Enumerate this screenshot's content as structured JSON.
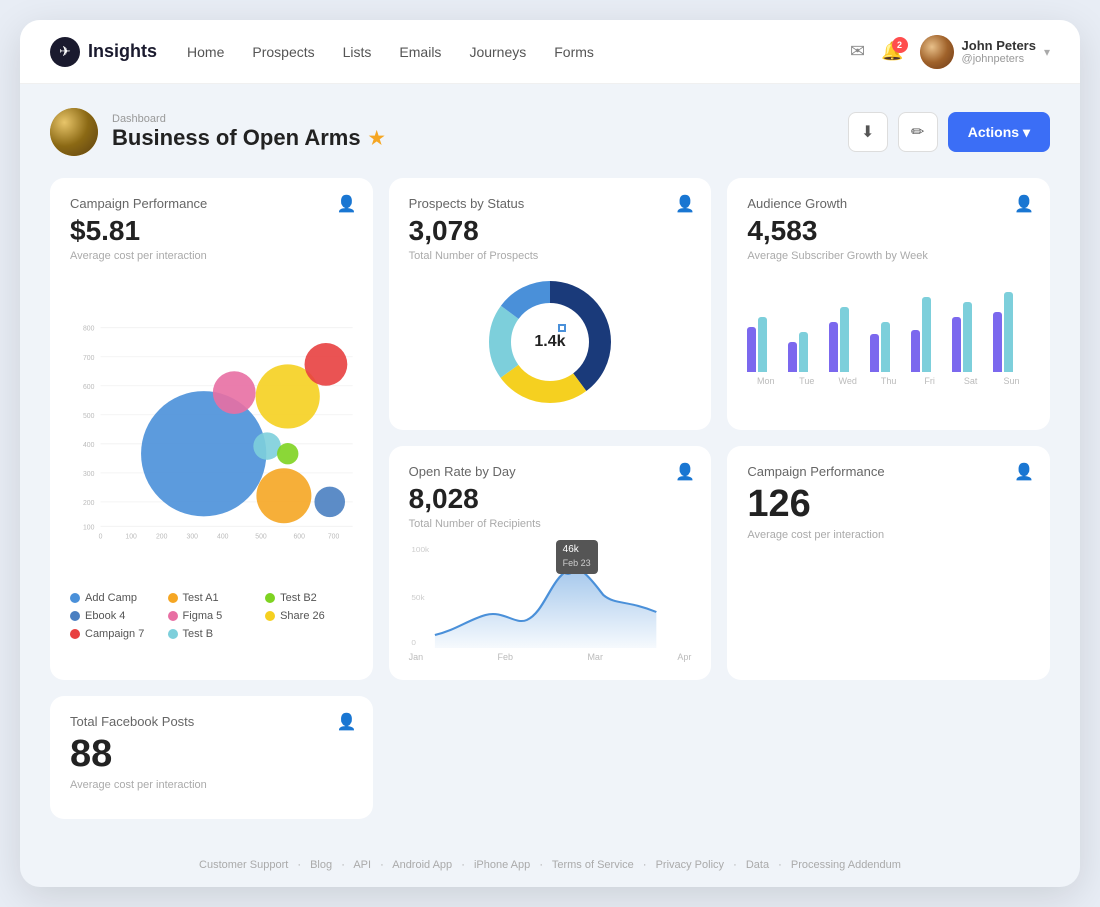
{
  "navbar": {
    "logo_text": "Insights",
    "logo_symbol": "✈",
    "nav_links": [
      "Home",
      "Prospects",
      "Lists",
      "Emails",
      "Journeys",
      "Forms"
    ],
    "notification_count": "2",
    "user_name": "John Peters",
    "user_handle": "@johnpeters"
  },
  "page_header": {
    "breadcrumb": "Dashboard",
    "title": "Business of Open Arms",
    "actions_label": "Actions ▾",
    "download_icon": "⬇",
    "edit_icon": "✏"
  },
  "campaign_performance_main": {
    "title": "Campaign Performance",
    "value": "$5.81",
    "sub": "Average cost per interaction"
  },
  "prospects_by_status": {
    "title": "Prospects by Status",
    "value": "3,078",
    "sub": "Total Number of Prospects",
    "donut_center": "1.4k"
  },
  "audience_growth": {
    "title": "Audience Growth",
    "value": "4,583",
    "sub": "Average Subscriber Growth by Week",
    "bar_days": [
      "Mon",
      "Tue",
      "Wed",
      "Thu",
      "Fri",
      "Sat",
      "Sun"
    ]
  },
  "open_rate_by_day": {
    "title": "Open Rate by Day",
    "value": "8,028",
    "sub": "Total Number of Recipients",
    "tooltip": "46k",
    "tooltip_date": "Feb 23",
    "x_labels": [
      "Jan",
      "Feb",
      "Mar",
      "Apr"
    ]
  },
  "campaign_performance_small": {
    "title": "Campaign Performance",
    "value": "126",
    "sub": "Average cost per interaction"
  },
  "total_facebook": {
    "title": "Total Facebook Posts",
    "value": "88",
    "sub": "Average cost per interaction"
  },
  "legend": [
    {
      "label": "Add Camp",
      "color": "#4a90d9"
    },
    {
      "label": "Test A1",
      "color": "#f5a623"
    },
    {
      "label": "Test B2",
      "color": "#7ed321"
    },
    {
      "label": "Ebook 4",
      "color": "#4a7fc1"
    },
    {
      "label": "Figma 5",
      "color": "#e86fa3"
    },
    {
      "label": "Share 26",
      "color": "#f5d020"
    },
    {
      "label": "Campaign 7",
      "color": "#e84040"
    },
    {
      "label": "Test B",
      "color": "#7dcfdb"
    }
  ],
  "footer_links": [
    "Customer Support",
    "Blog",
    "API",
    "Android App",
    "iPhone App",
    "Terms of Service",
    "Privacy Policy",
    "Data",
    "Processing Addendum"
  ]
}
